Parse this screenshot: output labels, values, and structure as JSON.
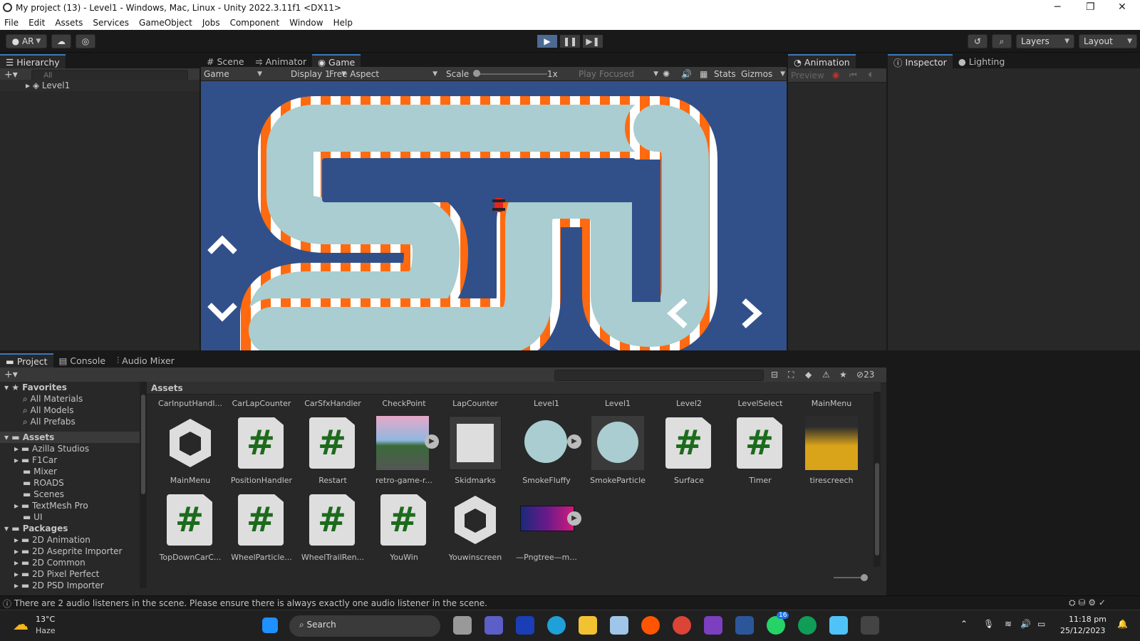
{
  "window": {
    "title": "My project (13) - Level1 - Windows, Mac, Linux - Unity 2022.3.11f1 <DX11>"
  },
  "menu": [
    "File",
    "Edit",
    "Assets",
    "Services",
    "GameObject",
    "Jobs",
    "Component",
    "Window",
    "Help"
  ],
  "toolbar": {
    "account": "AR",
    "layers": "Layers",
    "layout": "Layout"
  },
  "hierarchy": {
    "tab": "Hierarchy",
    "search_placeholder": "All",
    "root": "Level1"
  },
  "center_tabs": [
    "Scene",
    "Animator",
    "Game"
  ],
  "game_bar": {
    "mode": "Game",
    "display": "Display 1",
    "aspect": "Free Aspect",
    "scale_label": "Scale",
    "scale_value": "1x",
    "play_focused": "Play Focused",
    "stats": "Stats",
    "gizmos": "Gizmos"
  },
  "animation": {
    "tab": "Animation",
    "preview": "Preview"
  },
  "right_tabs": [
    "Inspector",
    "Lighting"
  ],
  "bottom_tabs": [
    "Project",
    "Console",
    "Audio Mixer"
  ],
  "project": {
    "hidden_count": "23",
    "breadcrumb": "Assets",
    "favorites_label": "Favorites",
    "favorites": [
      "All Materials",
      "All Models",
      "All Prefabs"
    ],
    "assets_label": "Assets",
    "asset_folders": [
      "Azilla Studios",
      "F1Car",
      "Mixer",
      "ROADS",
      "Scenes",
      "TextMesh Pro",
      "UI"
    ],
    "packages_label": "Packages",
    "packages": [
      "2D Animation",
      "2D Aseprite Importer",
      "2D Common",
      "2D Pixel Perfect",
      "2D PSD Importer"
    ],
    "row0": [
      "CarInputHandl...",
      "CarLapCounter",
      "CarSfxHandler",
      "CheckPoint",
      "LapCounter",
      "Level1",
      "Level1",
      "Level2",
      "LevelSelect",
      "MainMenu"
    ],
    "row1": [
      "MainMenu",
      "PositionHandler",
      "Restart",
      "retro-game-r...",
      "Skidmarks",
      "SmokeFluffy",
      "SmokeParticle",
      "Surface",
      "Timer",
      "tirescreech"
    ],
    "row2": [
      "TopDownCarC...",
      "WheelParticle...",
      "WheelTrailRen...",
      "YouWin",
      "Youwinscreen",
      "—Pngtree—m..."
    ]
  },
  "status": {
    "message": "There are 2 audio listeners in the scene. Please ensure there is always exactly one audio listener in the scene."
  },
  "taskbar": {
    "temp": "13°C",
    "weather": "Haze",
    "search": "Search",
    "time": "11:18 pm",
    "date": "25/12/2023",
    "badge1": "16"
  }
}
